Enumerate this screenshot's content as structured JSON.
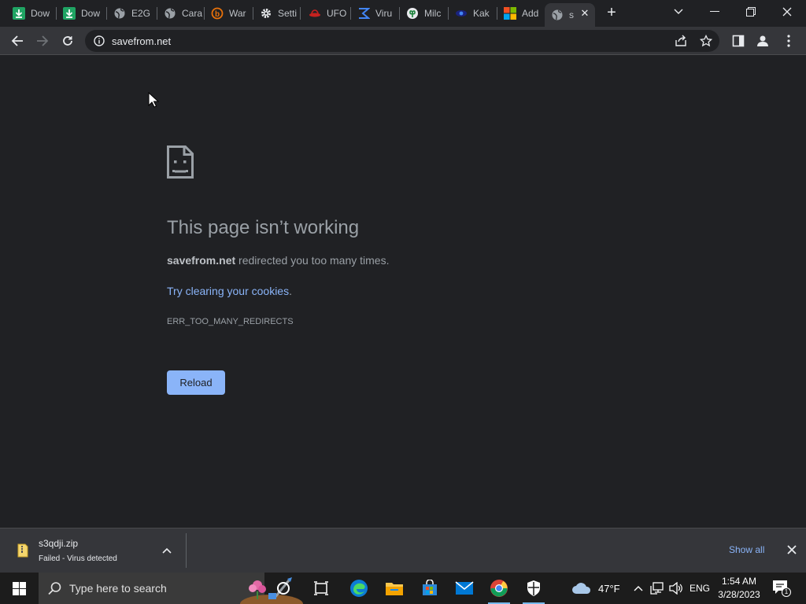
{
  "tabs": [
    {
      "title": "Dow",
      "icon": "download-arrow-icon"
    },
    {
      "title": "Dow",
      "icon": "download-arrow-icon"
    },
    {
      "title": "E2G",
      "icon": "globe-icon"
    },
    {
      "title": "Cara",
      "icon": "globe-icon"
    },
    {
      "title": "War",
      "icon": "b-logo-icon"
    },
    {
      "title": "Setti",
      "icon": "gear-icon"
    },
    {
      "title": "UFO",
      "icon": "ufo-icon"
    },
    {
      "title": "Viru",
      "icon": "sigma-icon"
    },
    {
      "title": "Milc",
      "icon": "leaf-icon"
    },
    {
      "title": "Kak",
      "icon": "eye-icon"
    },
    {
      "title": "Add",
      "icon": "microsoft-icon"
    },
    {
      "title": "s",
      "icon": "globe-icon"
    }
  ],
  "toolbar": {
    "url": "savefrom.net"
  },
  "error": {
    "title": "This page isn’t working",
    "domain": "savefrom.net",
    "desc_rest": " redirected you too many times.",
    "link": "Try clearing your cookies",
    "link_tail": ".",
    "code": "ERR_TOO_MANY_REDIRECTS",
    "reload": "Reload"
  },
  "download": {
    "filename": "s3qdji.zip",
    "status": "Failed - Virus detected",
    "show_all": "Show all"
  },
  "taskbar": {
    "search_placeholder": "Type here to search",
    "weather_temp": "47°F",
    "language": "ENG",
    "time": "1:54 AM",
    "date": "3/28/2023",
    "notification_count": "1"
  },
  "colors": {
    "accent": "#8ab4f8",
    "background": "#202124",
    "toolbar": "#35363a"
  }
}
